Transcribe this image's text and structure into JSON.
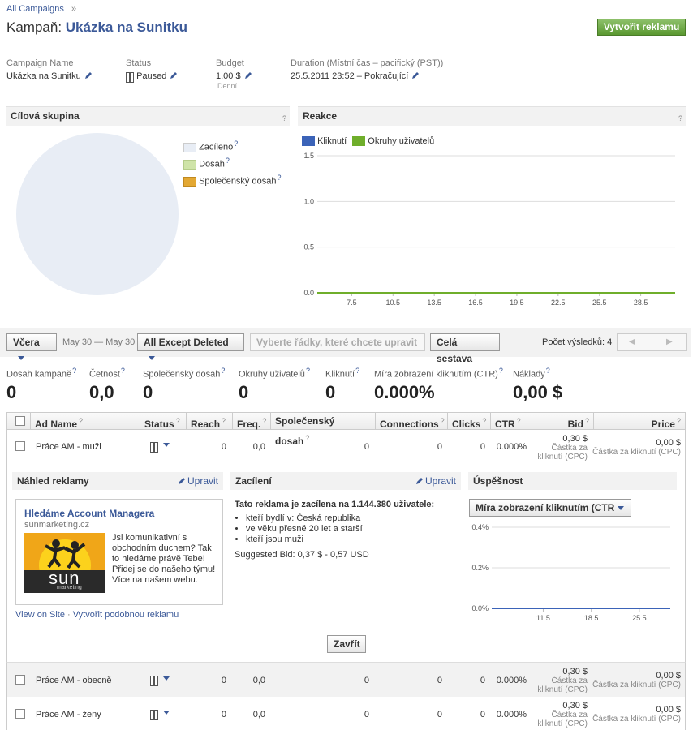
{
  "breadcrumb": {
    "link": "All Campaigns",
    "sep": "»"
  },
  "header": {
    "prefix": "Kampaň:",
    "title": "Ukázka na Sunitku",
    "create_button": "Vytvořit reklamu"
  },
  "info": {
    "name_label": "Campaign Name",
    "name_value": "Ukázka na Sunitku",
    "status_label": "Status",
    "status_value": "Paused",
    "budget_label": "Budget",
    "budget_value": "1,00 $",
    "budget_sub": "Denní",
    "duration_label": "Duration (Místní čas – pacifický (PST))",
    "duration_value": "25.5.2011 23:52 – Pokračující"
  },
  "audience": {
    "title": "Cílová skupina",
    "help": "?",
    "legend": [
      {
        "label": "Zacíleno",
        "color": "#e8edf5"
      },
      {
        "label": "Dosah",
        "color": "#cfe4a8"
      },
      {
        "label": "Společenský dosah",
        "color": "#e3a833"
      }
    ]
  },
  "reakce": {
    "title": "Reakce",
    "help": "?",
    "legend": [
      {
        "label": "Kliknutí",
        "color": "#3b63b8"
      },
      {
        "label": "Okruhy uživatelů",
        "color": "#6fae2b"
      }
    ]
  },
  "toolbar": {
    "period": "Včera",
    "date_range": "May 30 — May 30",
    "filter": "All Except Deleted",
    "edit_rows": "Vyberte řádky, které chcete upravit",
    "full_report": "Celá sestava",
    "result_count": "Počet výsledků: 4",
    "prev": "◀",
    "next": "▶"
  },
  "stats": [
    {
      "label": "Dosah kampaně",
      "value": "0"
    },
    {
      "label": "Četnost",
      "value": "0,0"
    },
    {
      "label": "Společenský dosah",
      "value": "0"
    },
    {
      "label": "Okruhy uživatelů",
      "value": "0"
    },
    {
      "label": "Kliknutí",
      "value": "0"
    },
    {
      "label": "Míra zobrazení kliknutím (CTR)",
      "value": "0.000%"
    },
    {
      "label": "Náklady",
      "value": "0,00 $"
    }
  ],
  "columns": [
    "Ad Name",
    "Status",
    "Reach",
    "Freq.",
    "Společenský dosah",
    "Connections",
    "Clicks",
    "CTR",
    "Bid",
    "Price"
  ],
  "rows": [
    {
      "name": "Práce AM - muži",
      "reach": "0",
      "freq": "0,0",
      "social": "0",
      "conn": "0",
      "clicks": "0",
      "ctr": "0.000%",
      "bid": "0,30 $",
      "bid_sub": "Částka za kliknutí (CPC)",
      "price": "0,00 $",
      "price_sub": "Částka za kliknutí (CPC)"
    },
    {
      "name": "Práce AM - obecně",
      "reach": "0",
      "freq": "0,0",
      "social": "0",
      "conn": "0",
      "clicks": "0",
      "ctr": "0.000%",
      "bid": "0,30 $",
      "bid_sub": "Částka za kliknutí (CPC)",
      "price": "0,00 $",
      "price_sub": "Částka za kliknutí (CPC)"
    },
    {
      "name": "Práce AM - ženy",
      "reach": "0",
      "freq": "0,0",
      "social": "0",
      "conn": "0",
      "clicks": "0",
      "ctr": "0.000%",
      "bid": "0,30 $",
      "bid_sub": "Částka za kliknutí (CPC)",
      "price": "0,00 $",
      "price_sub": "Částka za kliknutí (CPC)"
    }
  ],
  "preview": {
    "title": "Náhled reklamy",
    "edit": "Upravit",
    "ad_title": "Hledáme Account Managera",
    "ad_url": "sunmarketing.cz",
    "ad_body": "Jsi komunikativní s obchodním duchem? Tak to hledáme právě Tebe! Přidej se do našeho týmu! Více na našem webu.",
    "logo_text": "sun",
    "logo_sub": "marketing",
    "view_on_site": "View on Site",
    "dot": "·",
    "similar": "Vytvořit podobnou reklamu"
  },
  "targeting": {
    "title": "Zacílení",
    "edit": "Upravit",
    "headline": "Tato reklama je zacílena na 1.144.380 uživatele:",
    "items": [
      "kteří bydlí v: Česká republika",
      "ve věku přesně 20 let a starší",
      "kteří jsou muži"
    ],
    "suggested": "Suggested Bid: 0,37 $ - 0,57 USD"
  },
  "performance": {
    "title": "Úspěšnost",
    "metric": "Míra zobrazení kliknutím (CTR"
  },
  "close_button": "Zavřít",
  "chart_data": [
    {
      "type": "line",
      "title": "Reakce",
      "x_ticks": [
        "7.5",
        "10.5",
        "13.5",
        "16.5",
        "19.5",
        "22.5",
        "25.5",
        "28.5"
      ],
      "y_ticks": [
        "1.5",
        "1.0",
        "0.5",
        "0.0"
      ],
      "ylim": [
        0,
        1.5
      ],
      "xlim": [
        5,
        31
      ],
      "series": [
        {
          "name": "Kliknutí",
          "color": "#3b63b8",
          "x": [
            5,
            31
          ],
          "y": [
            0,
            0
          ]
        },
        {
          "name": "Okruhy uživatelů",
          "color": "#6fae2b",
          "x": [
            5,
            31
          ],
          "y": [
            0,
            0
          ]
        }
      ],
      "legend": "top-left",
      "grid": true
    },
    {
      "type": "line",
      "title": "Úspěšnost",
      "x_ticks": [
        "11.5",
        "18.5",
        "25.5"
      ],
      "y_ticks": [
        "0.4%",
        "0.2%",
        "0.0%"
      ],
      "ylim": [
        0,
        0.4
      ],
      "xlim": [
        4,
        30
      ],
      "series": [
        {
          "color": "#3b63b8",
          "x": [
            4,
            30
          ],
          "y": [
            0,
            0
          ]
        }
      ],
      "grid": true
    }
  ]
}
